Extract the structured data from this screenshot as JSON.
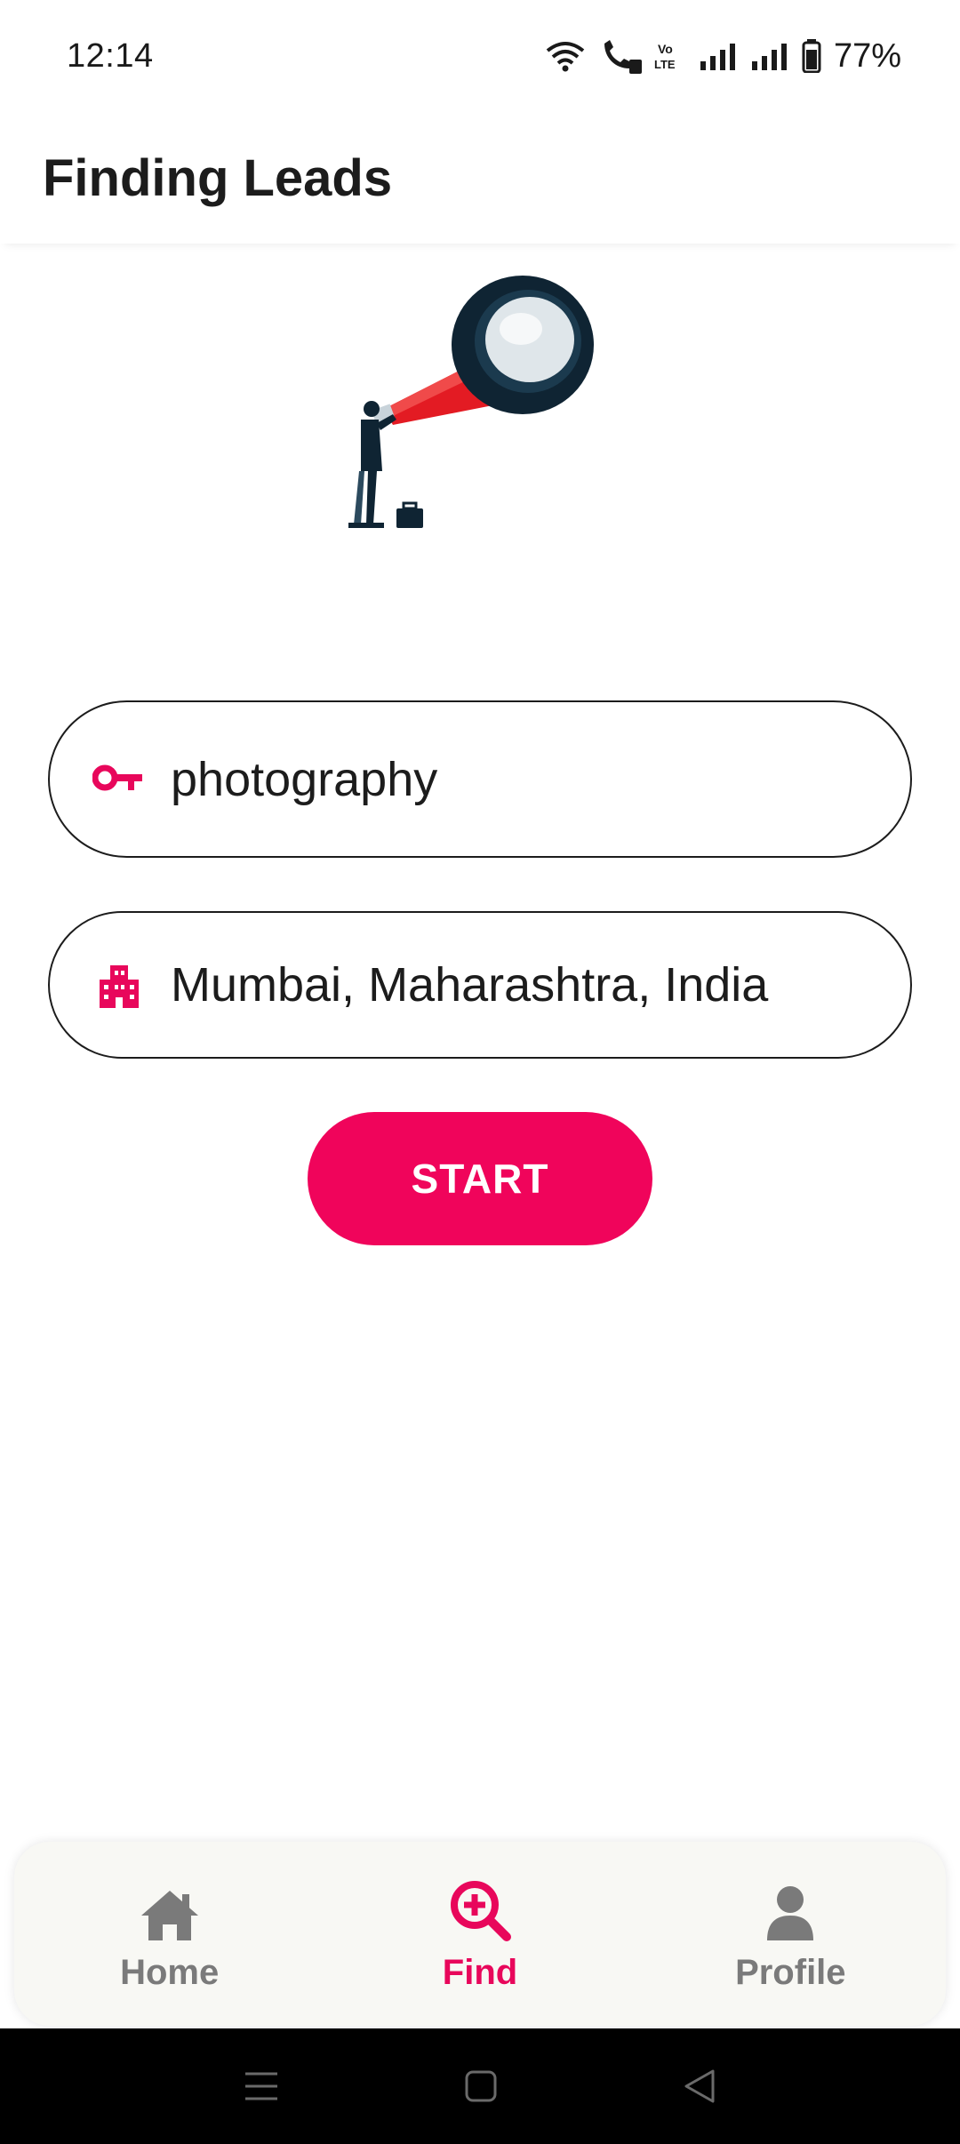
{
  "status_bar": {
    "time": "12:14",
    "battery": "77%",
    "icons": [
      "wifi-icon",
      "wifi-call-icon",
      "volte-icon",
      "signal-icon",
      "signal-icon",
      "battery-icon"
    ]
  },
  "app_bar": {
    "title": "Finding Leads"
  },
  "illustration": {
    "icon": "telescope-businessman-illustration"
  },
  "search": {
    "keyword_value": "photography",
    "keyword_icon": "key-icon",
    "location_value": "Mumbai, Maharashtra, India",
    "location_icon": "city-icon"
  },
  "actions": {
    "start_label": "START"
  },
  "bottom_nav": {
    "items": [
      {
        "label": "Home",
        "icon": "home-icon",
        "active": false
      },
      {
        "label": "Find",
        "icon": "search-plus-icon",
        "active": true
      },
      {
        "label": "Profile",
        "icon": "person-icon",
        "active": false
      }
    ]
  },
  "colors": {
    "accent": "#f0045b",
    "nav_inactive": "#7a7a7a",
    "nav_background": "#f8f8f4",
    "system_nav_background": "#000000"
  }
}
